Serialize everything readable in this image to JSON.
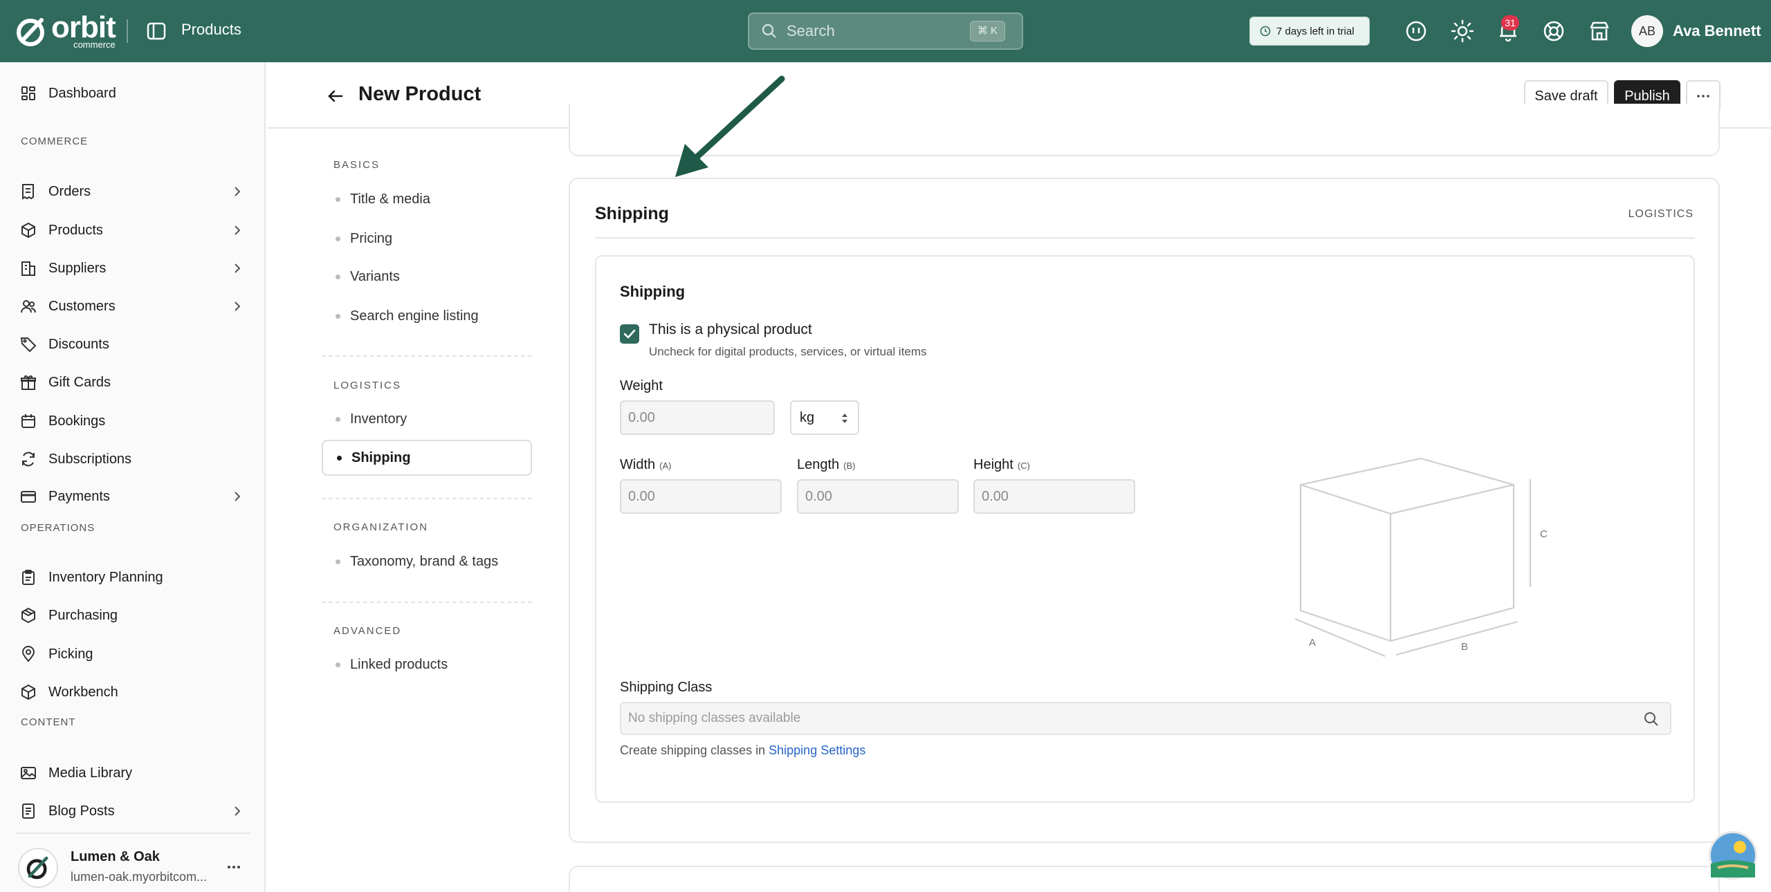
{
  "topbar": {
    "logo_word": "orbit",
    "logo_sub": "commerce",
    "section_title": "Products",
    "search_placeholder": "Search",
    "search_shortcut": "⌘ K",
    "trial_text": "7 days left in trial",
    "notification_count": "31",
    "avatar_initials": "AB",
    "user_name": "Ava Bennett",
    "bar_color": "#2f6a5c"
  },
  "sidebar": {
    "dashboard": "Dashboard",
    "sections": {
      "commerce": "COMMERCE",
      "operations": "OPERATIONS",
      "content": "CONTENT"
    },
    "commerce_items": [
      "Orders",
      "Products",
      "Suppliers",
      "Customers",
      "Discounts",
      "Gift Cards",
      "Bookings",
      "Subscriptions",
      "Payments"
    ],
    "operations_items": [
      "Inventory Planning",
      "Purchasing",
      "Picking",
      "Workbench"
    ],
    "content_items": [
      "Media Library",
      "Blog Posts"
    ],
    "store_name": "Lumen & Oak",
    "store_url": "lumen-oak.myorbitcom..."
  },
  "header": {
    "title": "New Product",
    "save_draft": "Save draft",
    "publish": "Publish"
  },
  "subnav": {
    "basics_label": "BASICS",
    "basics": [
      "Title & media",
      "Pricing",
      "Variants",
      "Search engine listing"
    ],
    "logistics_label": "LOGISTICS",
    "logistics": [
      "Inventory",
      "Shipping"
    ],
    "organization_label": "ORGANIZATION",
    "organization": [
      "Taxonomy, brand & tags"
    ],
    "advanced_label": "ADVANCED",
    "advanced": [
      "Linked products"
    ]
  },
  "shipping_card": {
    "title": "Shipping",
    "tag": "LOGISTICS",
    "inner_title": "Shipping",
    "physical_label": "This is a physical product",
    "physical_help": "Uncheck for digital products, services, or virtual items",
    "physical_checked": true,
    "weight_label": "Weight",
    "weight_placeholder": "0.00",
    "weight_unit": "kg",
    "width_label": "Width",
    "width_tag": "(A)",
    "length_label": "Length",
    "length_tag": "(B)",
    "height_label": "Height",
    "height_tag": "(C)",
    "dim_placeholder": "0.00",
    "diagram_labels": {
      "a": "A",
      "b": "B",
      "c": "C"
    },
    "class_label": "Shipping Class",
    "class_placeholder": "No shipping classes available",
    "class_help_prefix": "Create shipping classes in",
    "class_help_link": "Shipping Settings"
  }
}
